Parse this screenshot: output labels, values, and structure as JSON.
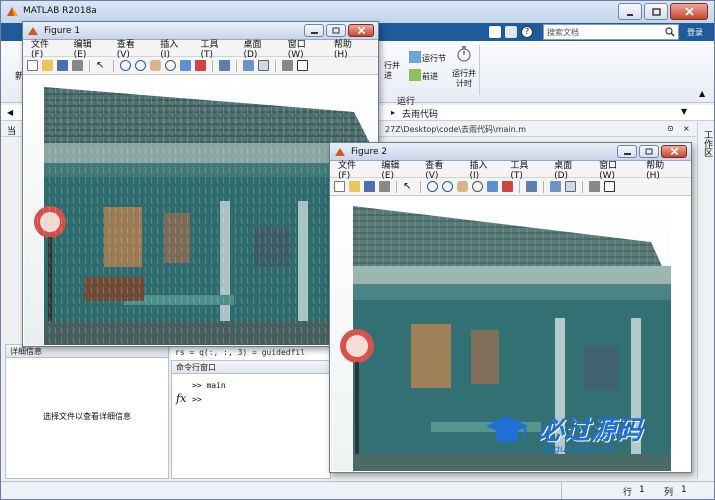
{
  "app": {
    "title": "MATLAB R2018a",
    "search_placeholder": "搜索文档",
    "tab_right": "登录"
  },
  "ribbon": {
    "new_label": "新",
    "run_section_label": "运行节",
    "run_advance_label": "前进",
    "run_and_time_label": "运行并\n计时",
    "run_section2": "行并\n进",
    "section_title": "运行"
  },
  "address": {
    "path_display": "去雨代码",
    "file_path": "27Z\\Desktop\\code\\去雨代码\\main.m"
  },
  "panels": {
    "left_label": "当",
    "details_title": "详细信息",
    "details_hint": "选择文件以查看详细信息",
    "workspace_label": "工作区"
  },
  "command": {
    "editor_line": "rs = q(:, :, 3) = guidedfil",
    "window_title": "命令行窗口",
    "history_line": ">> main",
    "prompt": ">>",
    "fx_icon": "fx"
  },
  "status": {
    "row_label": "行",
    "row_value": "1",
    "col_label": "列",
    "col_value": "1"
  },
  "figure1": {
    "title": "Figure 1",
    "menu": [
      "文件(F)",
      "编辑(E)",
      "查看(V)",
      "插入(I)",
      "工具(T)",
      "桌面(D)",
      "窗口(W)",
      "帮助(H)"
    ]
  },
  "figure2": {
    "title": "Figure 2",
    "menu": [
      "文件(F)",
      "编辑(E)",
      "查看(V)",
      "插入(I)",
      "工具(T)",
      "桌面(D)",
      "窗口(W)",
      "帮助(H)"
    ]
  },
  "watermark": {
    "text": "必过源码",
    "subtext": "Biguo100.com"
  },
  "colors": {
    "titlebar": "#c3d4ea",
    "accent": "#1f5a9a",
    "photo_teal": "#2d6f72"
  }
}
